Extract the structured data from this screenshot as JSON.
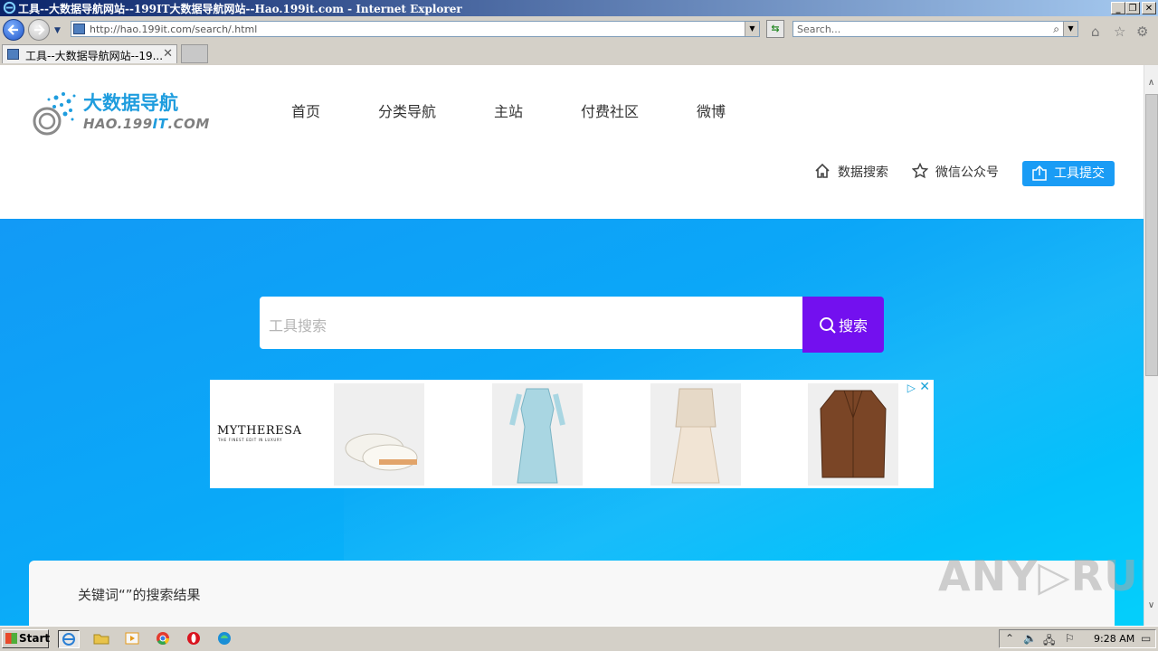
{
  "window": {
    "title": "工具--大数据导航网站--199IT大数据导航网站--Hao.199it.com - Internet Explorer"
  },
  "browser": {
    "url": "http://hao.199it.com/search/.html",
    "search_placeholder": "Search...",
    "tab_label": "工具--大数据导航网站--19..."
  },
  "site": {
    "logo_cn": "大数据导航",
    "logo_en_a": "HAO.199",
    "logo_en_b": "IT",
    "logo_en_c": ".COM",
    "nav": [
      "首页",
      "分类导航",
      "主站",
      "付费社区",
      "微博"
    ],
    "actions": {
      "data_search": "数据搜索",
      "wechat": "微信公众号",
      "submit_tool": "工具提交"
    },
    "search_placeholder": "工具搜索",
    "search_button": "搜索",
    "result_heading": "关键词“”的搜索结果"
  },
  "ad": {
    "brand": "MYTHERESA",
    "tagline": "THE FINEST EDIT IN LUXURY"
  },
  "watermark": "ANY▷RUN",
  "taskbar": {
    "start": "Start",
    "clock": "9:28 AM"
  },
  "colors": {
    "accent_blue": "#1a9cf5",
    "search_button": "#7310ef",
    "logo_blue": "#1f9dde"
  }
}
